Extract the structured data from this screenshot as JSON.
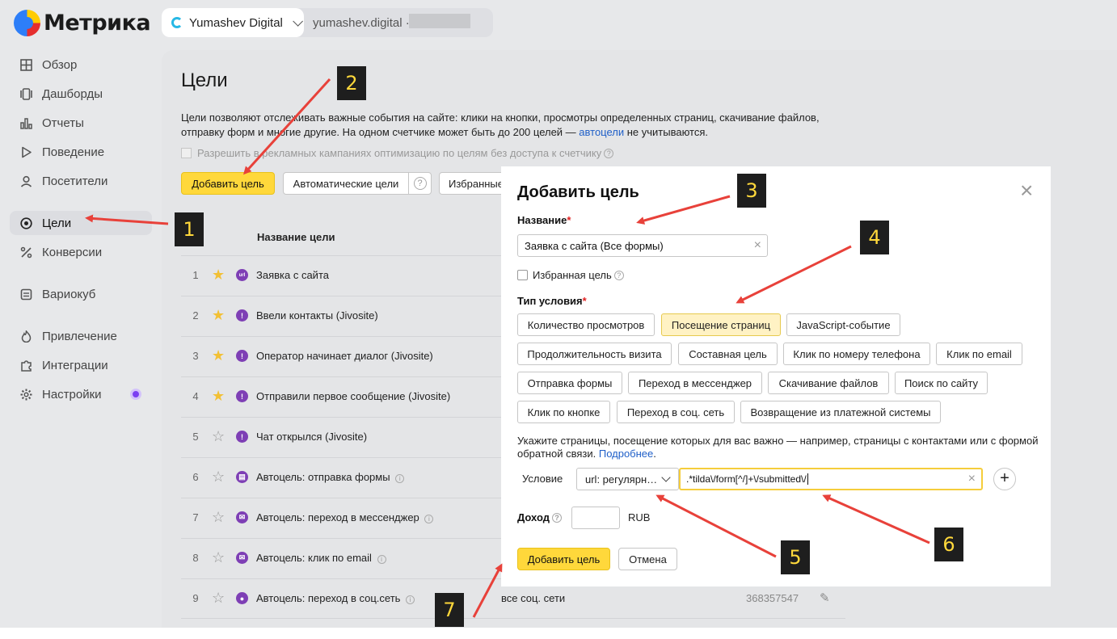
{
  "app": {
    "logo_text": "Метрика",
    "counter_name": "Yumashev Digital",
    "counter_domain": "yumashev.digital",
    "counter_separator": "·"
  },
  "sidebar": {
    "items": [
      {
        "label": "Обзор",
        "icon": "grid-icon"
      },
      {
        "label": "Дашборды",
        "icon": "dashboard-icon"
      },
      {
        "label": "Отчеты",
        "icon": "bar-chart-icon"
      },
      {
        "label": "Поведение",
        "icon": "play-icon"
      },
      {
        "label": "Посетители",
        "icon": "user-icon"
      },
      {
        "label": "Цели",
        "icon": "target-icon",
        "active": true
      },
      {
        "label": "Конверсии",
        "icon": "percent-icon"
      },
      {
        "label": "Вариокуб",
        "icon": "cube-icon"
      },
      {
        "label": "Привлечение",
        "icon": "flame-icon"
      },
      {
        "label": "Интеграции",
        "icon": "puzzle-icon"
      },
      {
        "label": "Настройки",
        "icon": "gear-icon"
      }
    ]
  },
  "page": {
    "title": "Цели",
    "desc_part1": "Цели позволяют отслеживать важные события на сайте: клики на кнопки, просмотры определенных страниц, скачивание файлов, отправку форм и многие другие. На одном счетчике может быть до 200 целей — ",
    "desc_link": "автоцели",
    "desc_part2": " не учитываются.",
    "allow_label": "Разрешить в рекламных кампаниях оптимизацию по целям без доступа к счетчику",
    "add_goal_button": "Добавить цель",
    "auto_goals_button": "Автоматические цели",
    "favorites_button": "Избранные",
    "help_mark": "?",
    "column_name": "Название цели"
  },
  "goals": [
    {
      "num": "1",
      "starred": true,
      "icon": "url",
      "name": "Заявка с сайта",
      "info": false,
      "condition": "",
      "id": ""
    },
    {
      "num": "2",
      "starred": true,
      "icon": "!",
      "name": "Ввели контакты (Jivosite)",
      "info": false,
      "condition": "",
      "id": ""
    },
    {
      "num": "3",
      "starred": true,
      "icon": "!",
      "name": "Оператор начинает диалог (Jivosite)",
      "info": false,
      "condition": "",
      "id": ""
    },
    {
      "num": "4",
      "starred": true,
      "icon": "!",
      "name": "Отправили первое сообщение (Jivosite)",
      "info": false,
      "condition": "",
      "id": ""
    },
    {
      "num": "5",
      "starred": false,
      "icon": "!",
      "name": "Чат открылся (Jivosite)",
      "info": false,
      "condition": "",
      "id": ""
    },
    {
      "num": "6",
      "starred": false,
      "icon": "▤",
      "name": "Автоцель: отправка формы",
      "info": true,
      "condition": "",
      "id": ""
    },
    {
      "num": "7",
      "starred": false,
      "icon": "✉",
      "name": "Автоцель: переход в мессенджер",
      "info": true,
      "condition": "",
      "id": ""
    },
    {
      "num": "8",
      "starred": false,
      "icon": "✉",
      "name": "Автоцель: клик по email",
      "info": true,
      "condition": "",
      "id": ""
    },
    {
      "num": "9",
      "starred": false,
      "icon": "●",
      "name": "Автоцель: переход в соц.сеть",
      "info": true,
      "condition": "все соц. сети",
      "id": "368357547"
    }
  ],
  "modal": {
    "title": "Добавить цель",
    "close": "×",
    "name_label": "Название",
    "required_mark": "*",
    "name_value": "Заявка с сайта (Все формы)",
    "clear": "×",
    "favorite_label": "Избранная цель",
    "type_label": "Тип условия",
    "types": [
      "Количество просмотров",
      "Посещение страниц",
      "JavaScript-событие",
      "Продолжительность визита",
      "Составная цель",
      "Клик по номеру телефона",
      "Клик по email",
      "Отправка формы",
      "Переход в мессенджер",
      "Скачивание файлов",
      "Поиск по сайту",
      "Клик по кнопке",
      "Переход в соц. сеть",
      "Возвращение из платежной системы"
    ],
    "selected_type": "Посещение страниц",
    "hint_text": "Укажите страницы, посещение которых для вас важно — например, страницы с контактами или с формой обратной связи. ",
    "hint_link": "Подробнее",
    "hint_end": ".",
    "condition_label": "Условие",
    "condition_type": "url: регулярн…",
    "condition_value": ".*tilda\\/form[^/]+\\/submitted\\/",
    "plus": "+",
    "income_label": "Доход",
    "currency": "RUB",
    "submit_button": "Добавить цель",
    "cancel_button": "Отмена"
  },
  "annotations": {
    "badges": [
      "1",
      "2",
      "3",
      "4",
      "5",
      "6",
      "7"
    ],
    "arrow_color": "#e8413a",
    "badge_bg": "#1e1e1e",
    "badge_fg": "#ffd83b"
  },
  "colors": {
    "accent": "#ffd83b",
    "link": "#1f5fc8",
    "goal_icon": "#7e3fb5",
    "star": "#f2c035"
  }
}
